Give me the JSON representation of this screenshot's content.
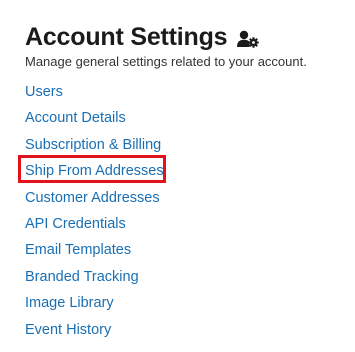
{
  "header": {
    "title": "Account Settings",
    "icon": "user-gear-icon",
    "subtitle": "Manage general settings related to your account."
  },
  "nav": {
    "items": [
      {
        "label": "Users"
      },
      {
        "label": "Account Details"
      },
      {
        "label": "Subscription & Billing"
      },
      {
        "label": "Ship From Addresses",
        "highlighted": true
      },
      {
        "label": "Customer Addresses"
      },
      {
        "label": "API Credentials"
      },
      {
        "label": "Email Templates"
      },
      {
        "label": "Branded Tracking"
      },
      {
        "label": "Image Library"
      },
      {
        "label": "Event History"
      }
    ]
  },
  "colors": {
    "title": "#1b1b1b",
    "link": "#1a6fb4",
    "highlight": "#e3121b"
  }
}
